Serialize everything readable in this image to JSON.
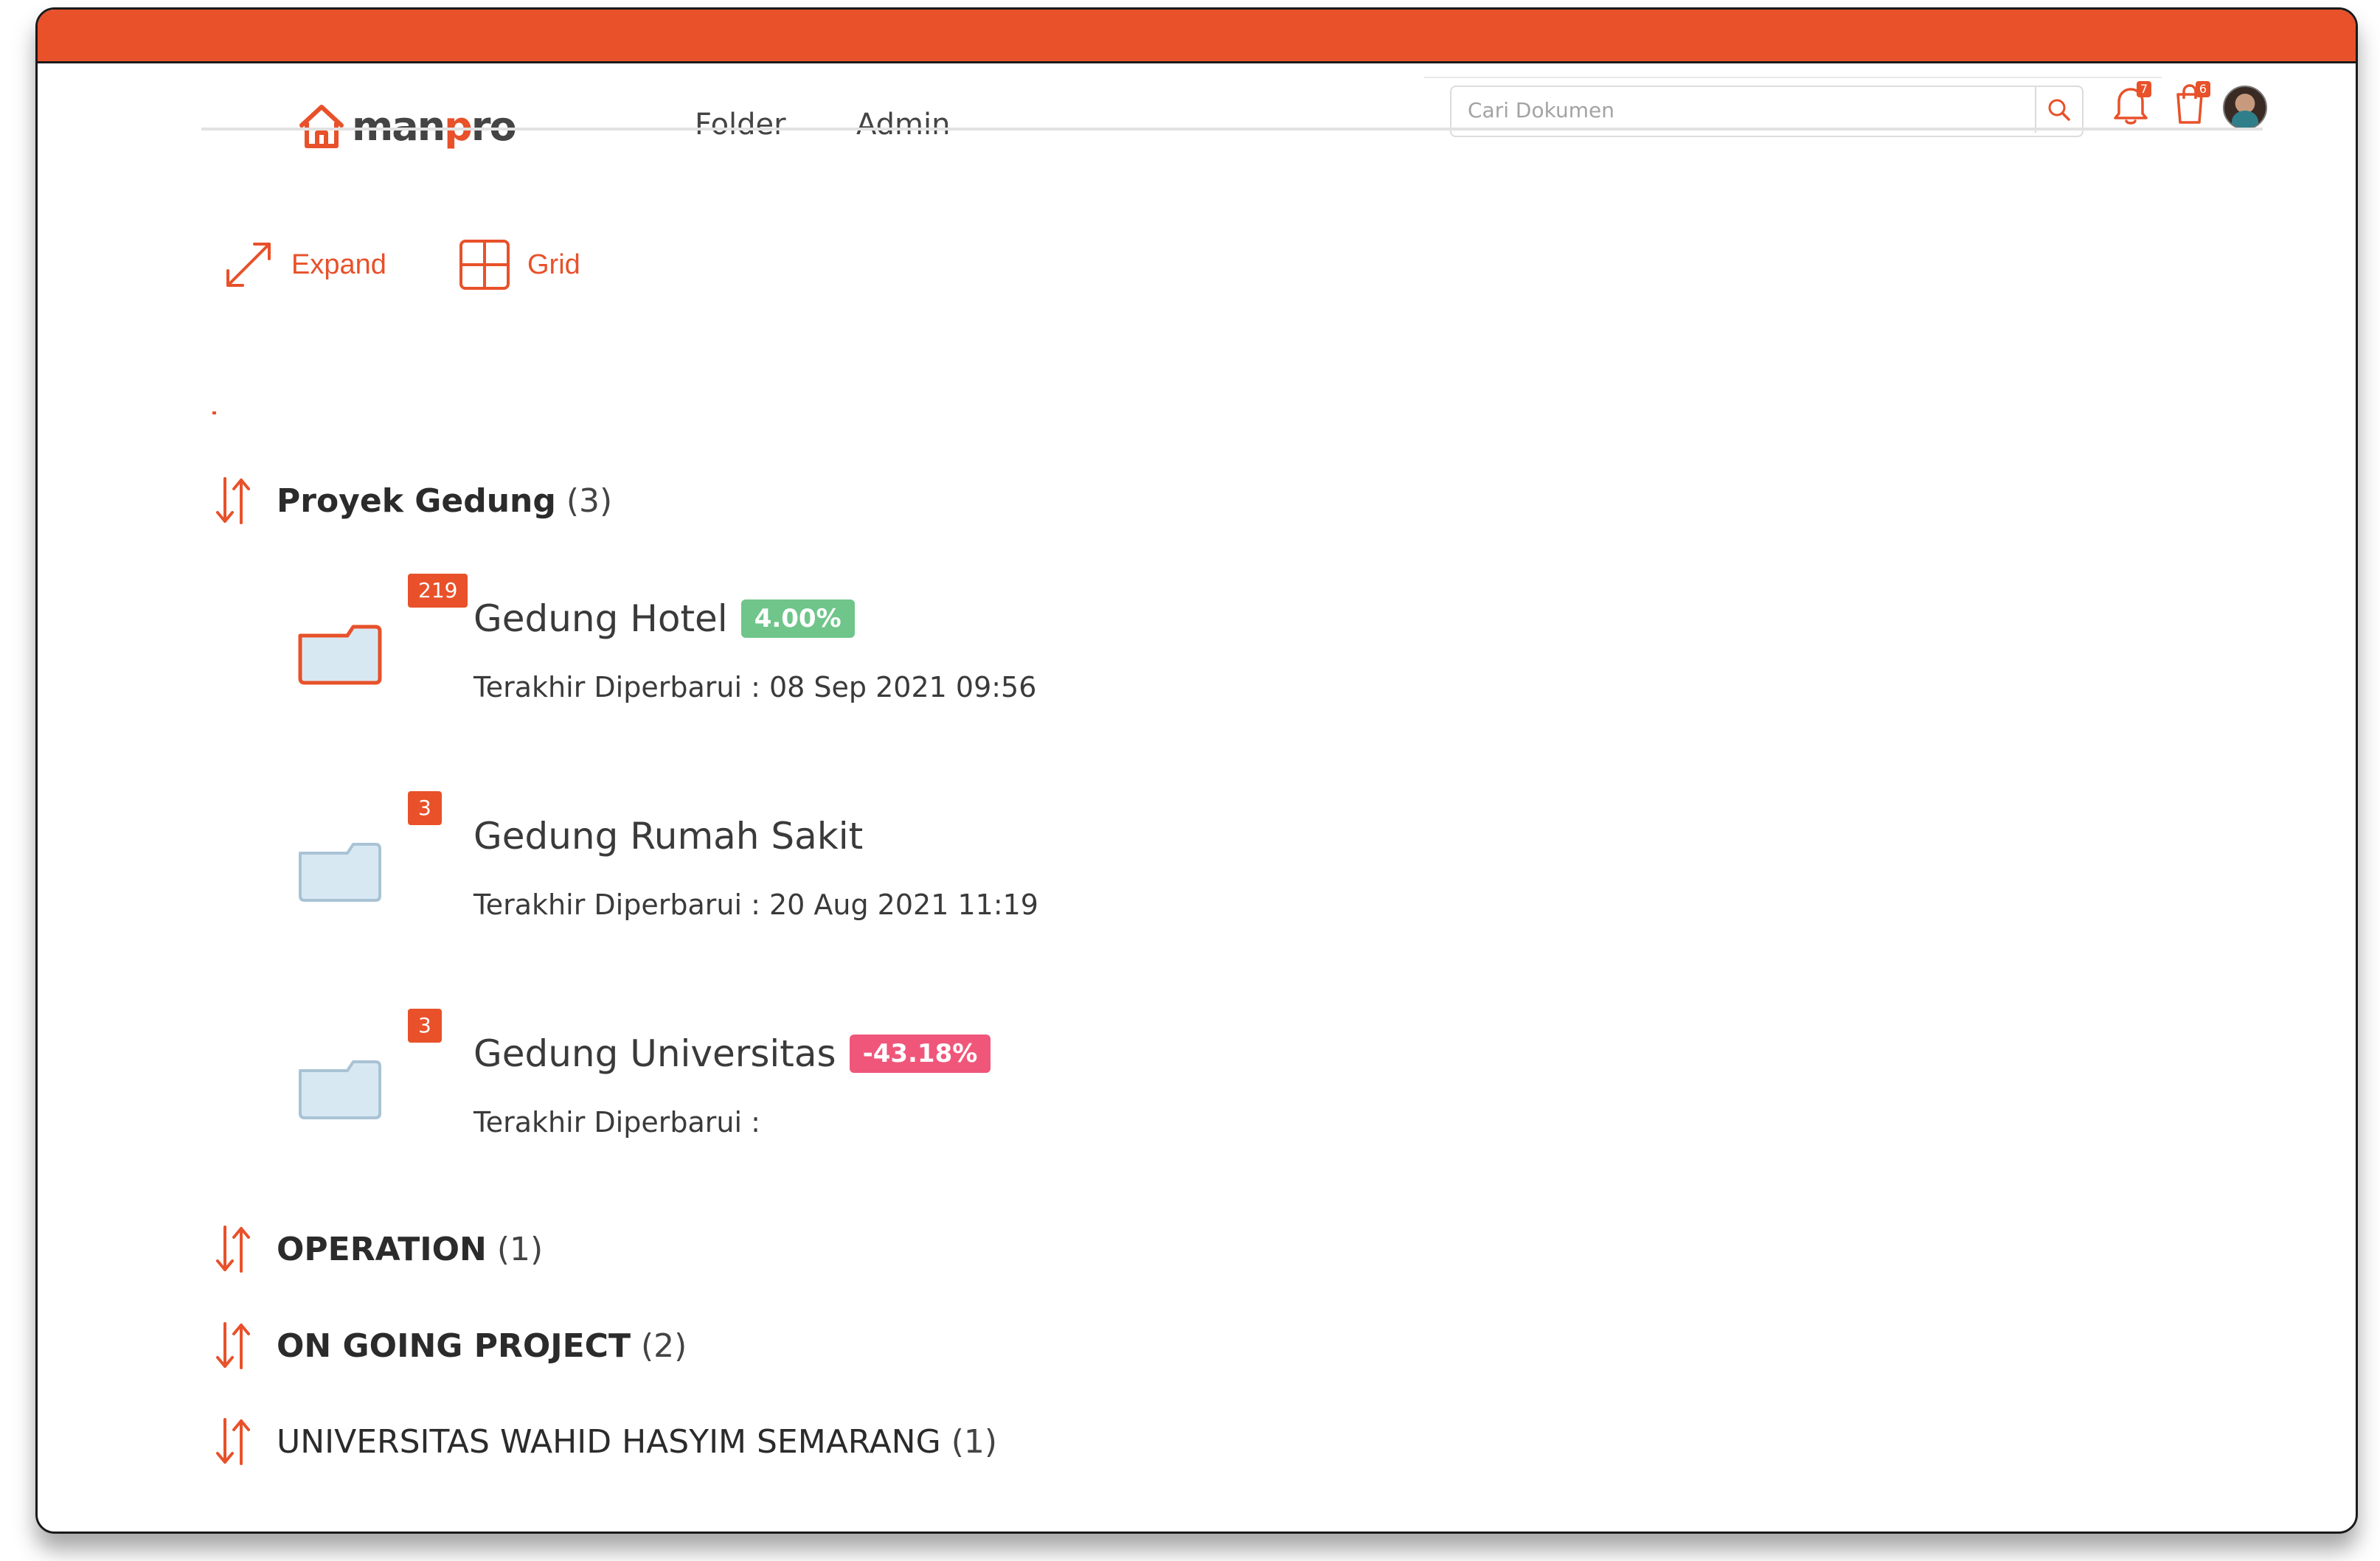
{
  "brand": {
    "name_pre": "man",
    "name_o": "p",
    "name_post": "ro",
    "accent": "#E8512A"
  },
  "nav": {
    "folder": "Folder",
    "admin": "Admin"
  },
  "search": {
    "placeholder": "Cari Dokumen"
  },
  "notifications": {
    "bell_count": "7",
    "cart_count": "6"
  },
  "toolbar": {
    "expand": "Expand",
    "grid": "Grid"
  },
  "groups": [
    {
      "title": "Proyek Gedung",
      "count": "(3)"
    },
    {
      "title": "OPERATION",
      "count": "(1)"
    },
    {
      "title": "ON GOING PROJECT",
      "count": "(2)"
    },
    {
      "title": "UNIVERSITAS WAHID HASYIM SEMARANG",
      "count": "(1)"
    }
  ],
  "items": [
    {
      "name": "Gedung Hotel",
      "badge": "219",
      "percent": "4.00%",
      "updated": "Terakhir Diperbarui : 08 Sep 2021 09:56"
    },
    {
      "name": "Gedung Rumah Sakit",
      "badge": "3",
      "percent": "",
      "updated": "Terakhir Diperbarui : 20 Aug 2021 11:19"
    },
    {
      "name": "Gedung Universitas",
      "badge": "3",
      "percent": "-43.18%",
      "updated": "Terakhir Diperbarui :"
    }
  ],
  "colors": {
    "positive": "#6FC58A",
    "negative": "#F0567A",
    "folder_fill": "#D8E8F2",
    "folder_stroke_active": "#E8512A",
    "folder_stroke": "#A9C3D5"
  }
}
